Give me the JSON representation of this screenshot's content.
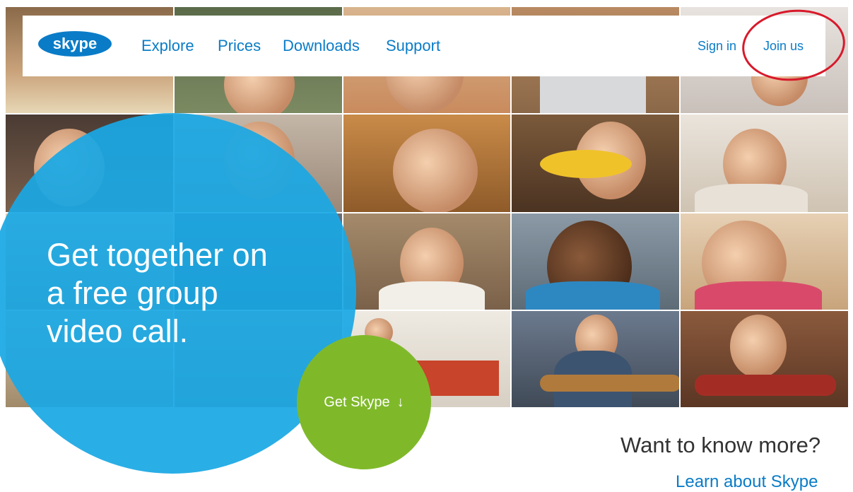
{
  "header": {
    "logo_text": "skype",
    "nav": [
      "Explore",
      "Prices",
      "Downloads",
      "Support"
    ],
    "sign_in": "Sign in",
    "join_us": "Join us"
  },
  "hero": {
    "headline_lines": [
      "Get together on",
      "a free group",
      "video call."
    ],
    "cta_label": "Get Skype",
    "cta_icon": "down-arrow-icon"
  },
  "footer": {
    "want_more": "Want to know more?",
    "learn_link": "Learn about Skype"
  },
  "colors": {
    "brand_blue": "#0a7cc7",
    "bubble_blue": "#1aa8e4",
    "cta_green": "#7fb92a",
    "highlight_red": "#d8192b"
  }
}
